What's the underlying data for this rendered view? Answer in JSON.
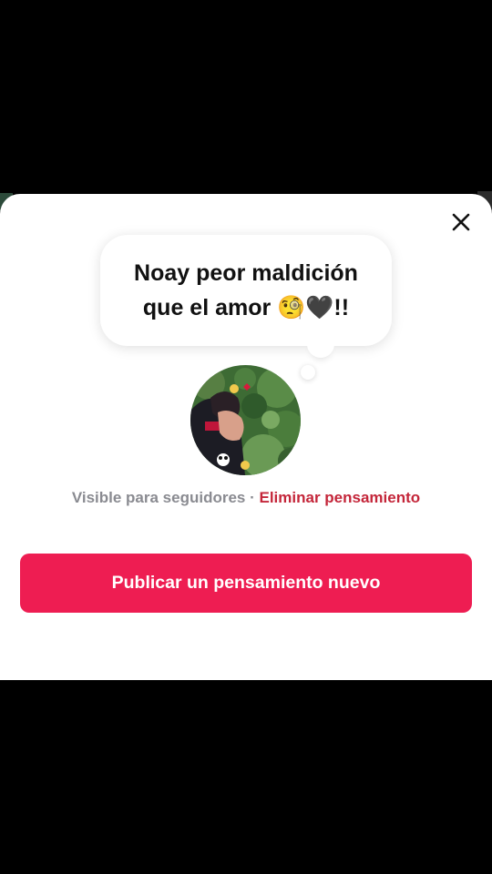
{
  "sheet": {
    "close_icon": "close-icon"
  },
  "thought": {
    "line1": "Noay peor maldición",
    "line2": "que el amor 🧐🖤!!"
  },
  "avatar": {
    "icon": "profile-photo"
  },
  "visibility": {
    "label": "Visible para seguidores",
    "separator": "·",
    "delete_label": "Eliminar pensamiento"
  },
  "publish_button": {
    "label": "Publicar un pensamiento nuevo"
  },
  "colors": {
    "accent": "#ee1d52",
    "delete": "#c4263a",
    "muted": "#8a8b91"
  }
}
